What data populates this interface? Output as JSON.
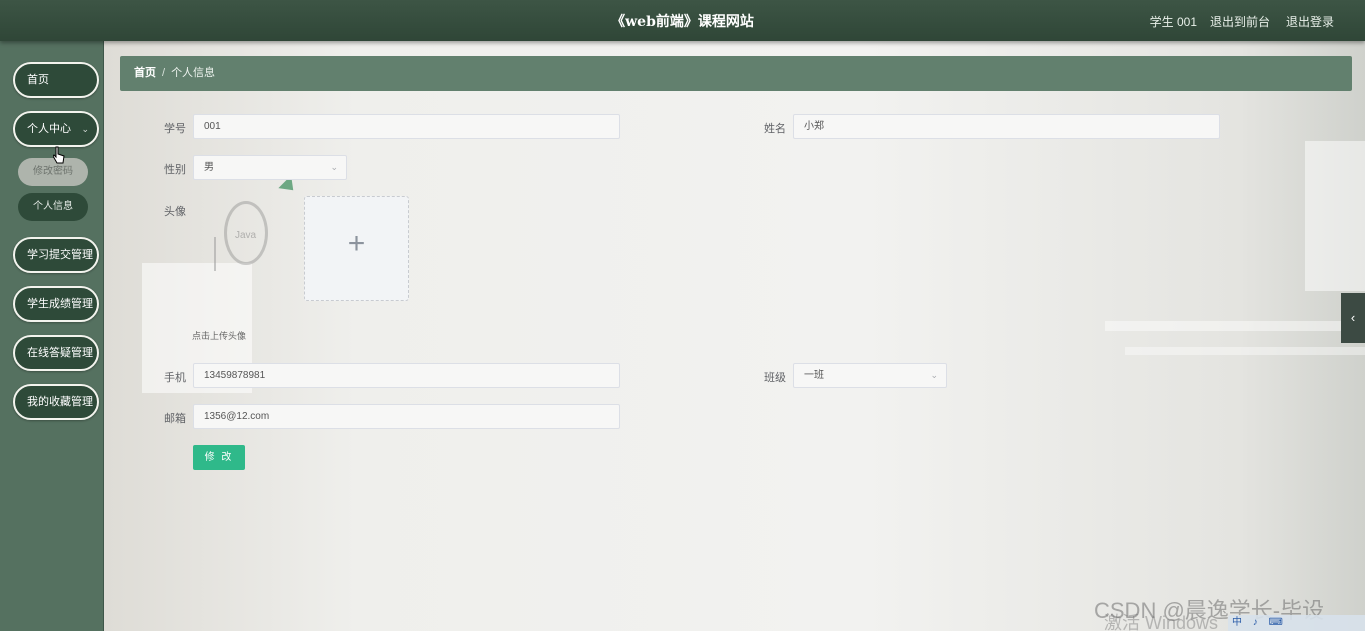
{
  "header": {
    "title": "《web前端》课程网站",
    "user_label": "学生 001",
    "front_link": "退出到前台",
    "logout_link": "退出登录"
  },
  "sidebar": {
    "items": [
      {
        "label": "首页"
      },
      {
        "label": "个人中心"
      },
      {
        "label": "学习提交管理"
      },
      {
        "label": "学生成绩管理"
      },
      {
        "label": "在线答疑管理"
      },
      {
        "label": "我的收藏管理"
      }
    ],
    "sub_items": [
      {
        "label": "修改密码"
      },
      {
        "label": "个人信息"
      }
    ]
  },
  "breadcrumb": {
    "home": "首页",
    "separator": "/",
    "current": "个人信息"
  },
  "form": {
    "student_id": {
      "label": "学号",
      "value": "001"
    },
    "name": {
      "label": "姓名",
      "value": "小郑"
    },
    "gender": {
      "label": "性别",
      "value": "男"
    },
    "avatar": {
      "label": "头像",
      "tip": "点击上传头像"
    },
    "phone": {
      "label": "手机",
      "value": "13459878981"
    },
    "class": {
      "label": "班级",
      "value": "一班"
    },
    "email": {
      "label": "邮箱",
      "value": "1356@12.com"
    },
    "submit_label": "修 改"
  },
  "overlay": {
    "bg_logo_text": "Java",
    "watermark": "CSDN @晨逸学长-毕设",
    "activate": "激活 Windows",
    "tray": "中 ♪ ⌨"
  },
  "icons": [
    "chevron-down-icon",
    "plus-icon",
    "chevron-left-icon",
    "cursor-icon"
  ]
}
